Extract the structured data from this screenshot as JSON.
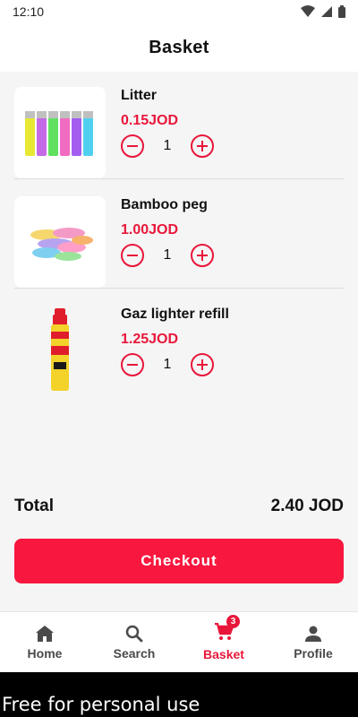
{
  "status_bar": {
    "time": "12:10"
  },
  "header": {
    "title": "Basket"
  },
  "cart": {
    "items": [
      {
        "name": "Litter",
        "price": "0.15JOD",
        "quantity": "1"
      },
      {
        "name": "Bamboo peg",
        "price": "1.00JOD",
        "quantity": "1"
      },
      {
        "name": "Gaz lighter refill",
        "price": "1.25JOD",
        "quantity": "1"
      }
    ]
  },
  "total": {
    "label": "Total",
    "value": "2.40 JOD"
  },
  "checkout": {
    "label": "Checkout"
  },
  "nav": {
    "items": [
      {
        "label": "Home"
      },
      {
        "label": "Search"
      },
      {
        "label": "Basket",
        "badge": "3"
      },
      {
        "label": "Profile"
      }
    ]
  },
  "watermark": "Free for personal use",
  "colors": {
    "accent": "#e8173a",
    "checkout": "#f8173e"
  }
}
